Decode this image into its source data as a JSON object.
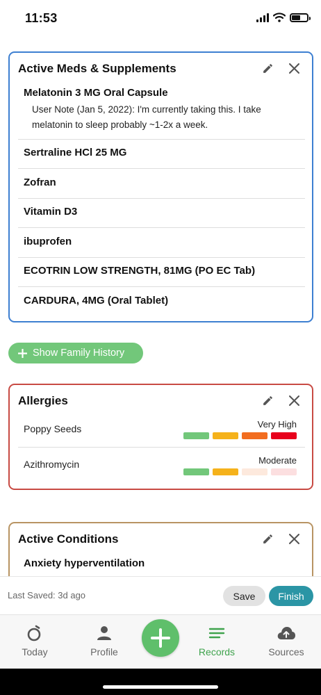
{
  "status": {
    "time": "11:53"
  },
  "meds": {
    "title": "Active Meds & Supplements",
    "items": [
      {
        "name": "Melatonin 3 MG Oral Capsule",
        "note_line1": "User Note (Jan 5, 2022): I'm currently taking this. I take",
        "note_line2": "melatonin to sleep probably ~1-2x a week."
      },
      {
        "name": "Sertraline HCl 25 MG"
      },
      {
        "name": "Zofran"
      },
      {
        "name": "Vitamin D3"
      },
      {
        "name": "ibuprofen"
      },
      {
        "name": "ECOTRIN LOW STRENGTH, 81MG (PO EC Tab)"
      },
      {
        "name": "CARDURA, 4MG (Oral Tablet)"
      }
    ]
  },
  "family_history": {
    "label": "Show Family History"
  },
  "allergies": {
    "title": "Allergies",
    "items": [
      {
        "name": "Poppy Seeds",
        "severity": "Very High",
        "level": 4,
        "bar_colors": [
          "#72c77a",
          "#f5b21b",
          "#f26d1f",
          "#e8001c"
        ]
      },
      {
        "name": "Azithromycin",
        "severity": "Moderate",
        "level": 2,
        "bar_colors": [
          "#72c77a",
          "#f5b21b",
          "#fde9dd",
          "#fcdfe0"
        ]
      }
    ]
  },
  "conditions": {
    "title": "Active Conditions",
    "items": [
      {
        "name": "Anxiety hyperventilation"
      }
    ]
  },
  "save_bar": {
    "last_saved": "Last Saved: 3d ago",
    "save_label": "Save",
    "finish_label": "Finish"
  },
  "tabs": [
    {
      "label": "Today",
      "icon": "today-icon"
    },
    {
      "label": "Profile",
      "icon": "person-icon"
    },
    {
      "label": "Records",
      "icon": "records-icon",
      "active": true
    },
    {
      "label": "Sources",
      "icon": "cloud-upload-icon"
    }
  ],
  "colors": {
    "meds_border": "#3d7fd1",
    "allergies_border": "#c84a43",
    "conditions_border": "#b89463",
    "accent_green": "#5fbf6b",
    "finish_teal": "#2b95a5"
  }
}
